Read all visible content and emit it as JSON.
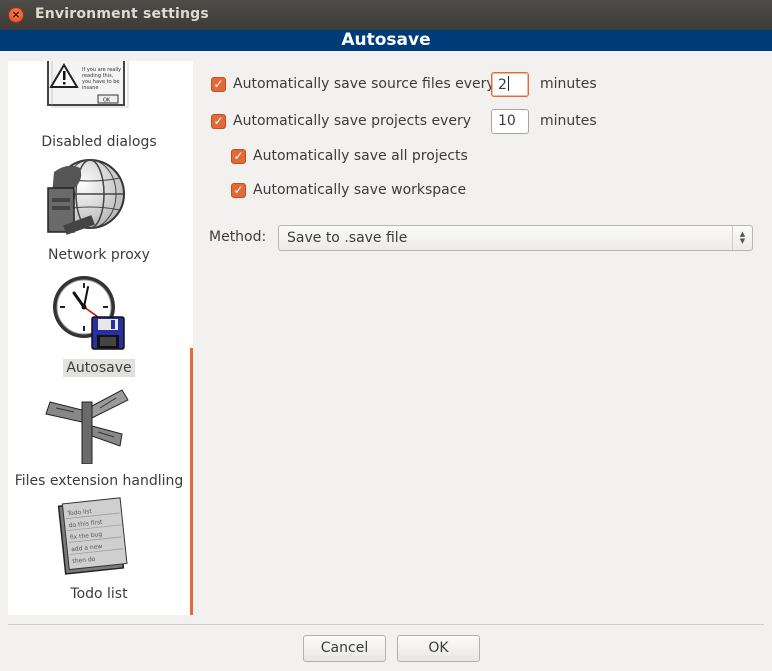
{
  "window": {
    "title": "Environment settings"
  },
  "banner": {
    "title": "Autosave"
  },
  "sidebar": {
    "items": [
      {
        "label": "Disabled dialogs",
        "icon": "warning-dialog-icon",
        "selected": false
      },
      {
        "label": "Network proxy",
        "icon": "globe-icon",
        "selected": false
      },
      {
        "label": "Autosave",
        "icon": "clock-floppy-icon",
        "selected": true
      },
      {
        "label": "Files extension handling",
        "icon": "signpost-icon",
        "selected": false
      },
      {
        "label": "Todo list",
        "icon": "notepad-icon",
        "selected": false
      }
    ],
    "dialog_icon_text": [
      "If you are really",
      "reading this,",
      "you have to be",
      "insane",
      "OK"
    ],
    "notepad_icon_text": [
      "Todo list",
      "do this first",
      "fix the bug",
      "add a new",
      "then do"
    ]
  },
  "autosave": {
    "source_files": {
      "label": "Automatically save source files every",
      "checked": true,
      "value": "2",
      "unit": "minutes"
    },
    "projects": {
      "label": "Automatically save projects every",
      "checked": true,
      "value": "10",
      "unit": "minutes"
    },
    "all_projects": {
      "label": "Automatically save all projects",
      "checked": true
    },
    "workspace": {
      "label": "Automatically save workspace",
      "checked": true
    },
    "method": {
      "label": "Method:",
      "selected": "Save to .save file"
    }
  },
  "buttons": {
    "cancel": "Cancel",
    "ok": "OK"
  },
  "colors": {
    "accent": "#e26a38",
    "banner": "#003b7a",
    "titlebar": "#3c3b37"
  }
}
